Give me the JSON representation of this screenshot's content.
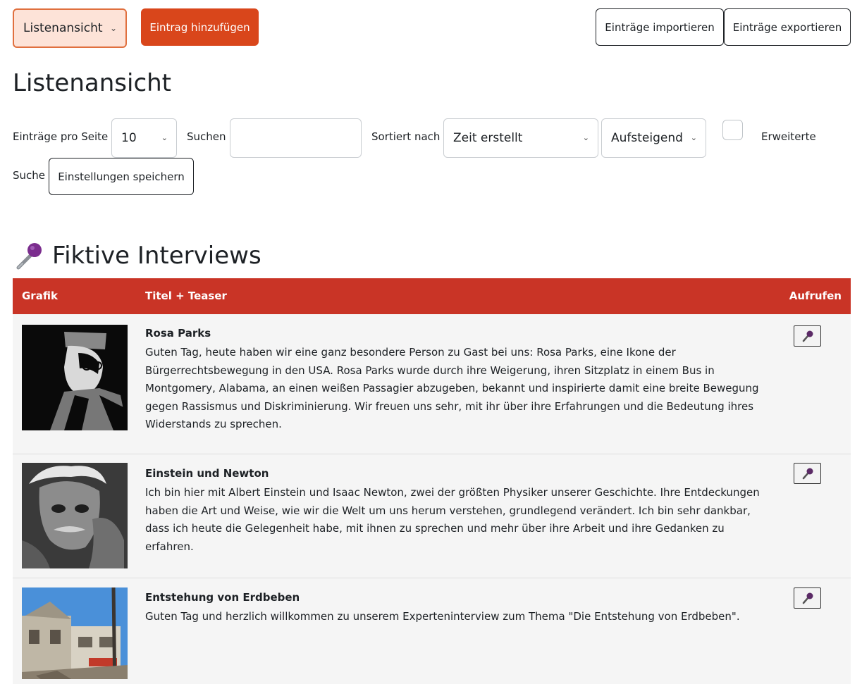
{
  "toolbar": {
    "view_select": "Listenansicht",
    "add_label": "Eintrag hinzufügen",
    "import_label": "Einträge importieren",
    "export_label": "Einträge exportieren"
  },
  "page_title": "Listenansicht",
  "filters": {
    "per_page_label": "Einträge pro Seite",
    "per_page_value": "10",
    "search_label": "Suchen",
    "search_value": "",
    "sort_label": "Sortiert nach",
    "sort_value": "Zeit erstellt",
    "order_value": "Aufsteigend",
    "advanced_label_1": "Erweiterte",
    "advanced_label_2": "Suche",
    "save_label": "Einstellungen speichern"
  },
  "section_title": "Fiktive Interviews",
  "table": {
    "columns": [
      "Grafik",
      "Titel + Teaser",
      "Aufrufen"
    ],
    "rows": [
      {
        "title": "Rosa Parks",
        "teaser": "Guten Tag, heute haben wir eine ganz besondere Person zu Gast bei uns: Rosa Parks, eine Ikone der Bürgerrechtsbewegung in den USA. Rosa Parks wurde durch ihre Weigerung, ihren Sitzplatz in einem Bus in Montgomery, Alabama, an einen weißen Passagier abzugeben, bekannt und inspirierte damit eine breite Bewegung gegen Rassismus und Diskriminierung. Wir freuen uns sehr, mit ihr über ihre Erfahrungen und die Bedeutung ihres Widerstands zu sprechen."
      },
      {
        "title": "Einstein und Newton",
        "teaser": "Ich bin hier mit Albert Einstein und Isaac Newton, zwei der größten Physiker unserer Geschichte. Ihre Entdeckungen haben die Art und Weise, wie wir die Welt um uns herum verstehen, grundlegend verändert. Ich bin sehr dankbar, dass ich heute die Gelegenheit habe, mit ihnen zu sprechen und mehr über ihre Arbeit und ihre Gedanken zu erfahren."
      },
      {
        "title": "Entstehung von Erdbeben",
        "teaser": "Guten Tag und herzlich willkommen zu unserem Experteninterview zum Thema \"Die Entstehung von Erdbeben\"."
      }
    ]
  },
  "icons": {
    "section": "microphone-icon",
    "call": "microphone-icon",
    "dropdown": "chevron-down-icon"
  },
  "colors": {
    "primary": "#d9461b",
    "header_bg": "#c93426",
    "view_select_bg": "#fde3d8",
    "row_bg": "#f5f5f5"
  }
}
